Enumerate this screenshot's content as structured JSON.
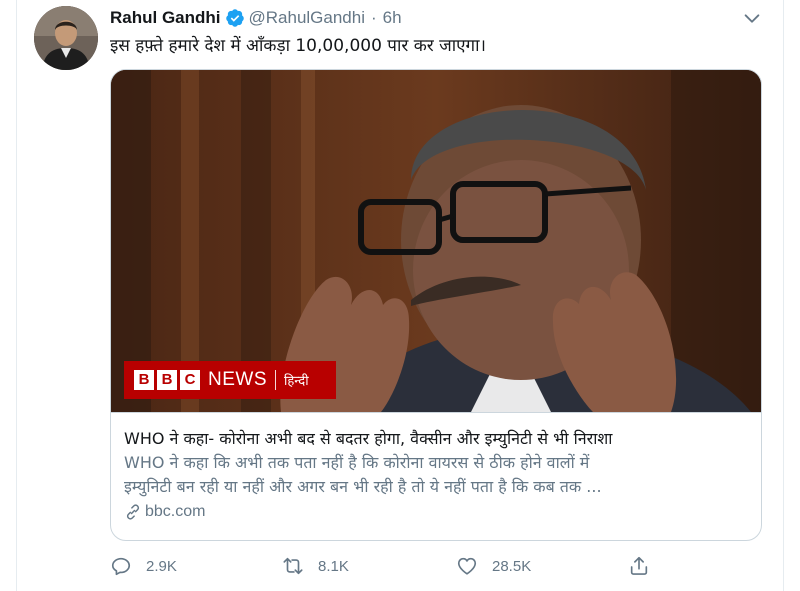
{
  "author": {
    "display_name": "Rahul Gandhi",
    "handle": "@RahulGandhi",
    "separator": "·",
    "time": "6h",
    "verified": true
  },
  "tweet": {
    "text": "इस हफ़्ते हमारे देश में आँकड़ा 10,00,000 पार कर जाएगा।"
  },
  "card": {
    "badge": {
      "blocks": [
        "B",
        "B",
        "C"
      ],
      "news": "NEWS",
      "language": "हिन्दी"
    },
    "title": "WHO ने कहा- कोरोना अभी बद से बदतर होगा, वैक्सीन और इम्युनिटी से भी निराशा",
    "description_line1": "WHO ने कहा कि अभी तक पता नहीं है कि कोरोना वायरस से ठीक होने वालों में",
    "description_line2": "इम्युनिटी बन रही या नहीं और अगर बन भी रही है तो ये नहीं पता है कि कब तक ...",
    "domain": "bbc.com"
  },
  "actions": {
    "reply_count": "2.9K",
    "retweet_count": "8.1K",
    "like_count": "28.5K"
  },
  "colors": {
    "brand_blue": "#1da1f2",
    "secondary_text": "#657786",
    "bbc_red": "#b80000"
  }
}
